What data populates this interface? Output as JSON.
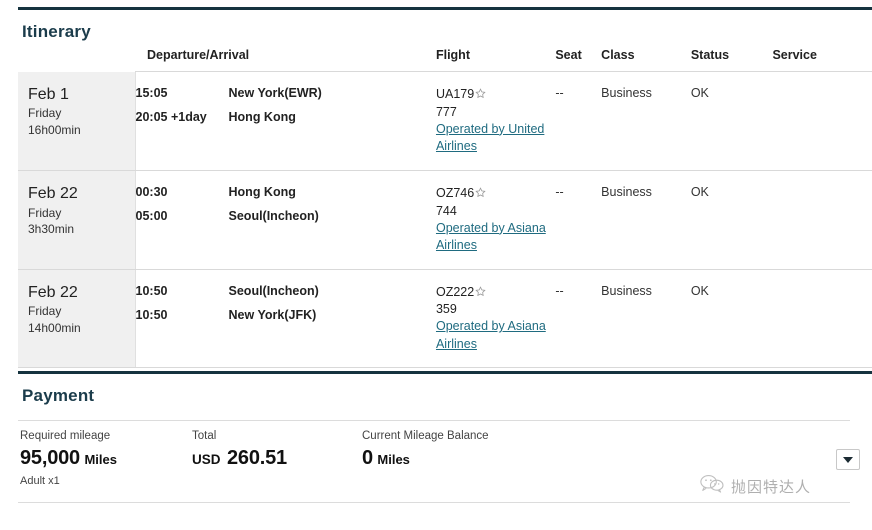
{
  "itinerary": {
    "title": "Itinerary",
    "columns": {
      "date": "",
      "departure_arrival": "Departure/Arrival",
      "flight": "Flight",
      "seat": "Seat",
      "class": "Class",
      "status": "Status",
      "service": "Service"
    },
    "rows": [
      {
        "date": "Feb 1",
        "weekday": "Friday",
        "duration": "16h00min",
        "depart_time": "15:05",
        "depart_place": "New York(EWR)",
        "arrive_time": "20:05 +1day",
        "arrive_place": "Hong Kong",
        "flight_number": "UA179",
        "star_icon": "star-icon",
        "aircraft": "777",
        "operated_by": "Operated by United Airlines",
        "seat": "--",
        "class": "Business",
        "status": "OK",
        "service": ""
      },
      {
        "date": "Feb 22",
        "weekday": "Friday",
        "duration": "3h30min",
        "depart_time": "00:30",
        "depart_place": "Hong Kong",
        "arrive_time": "05:00",
        "arrive_place": "Seoul(Incheon)",
        "flight_number": "OZ746",
        "star_icon": "star-icon",
        "aircraft": "744",
        "operated_by": "Operated by Asiana Airlines",
        "seat": "--",
        "class": "Business",
        "status": "OK",
        "service": ""
      },
      {
        "date": "Feb 22",
        "weekday": "Friday",
        "duration": "14h00min",
        "depart_time": "10:50",
        "depart_place": "Seoul(Incheon)",
        "arrive_time": "10:50",
        "arrive_place": "New York(JFK)",
        "flight_number": "OZ222",
        "star_icon": "star-icon",
        "aircraft": "359",
        "operated_by": "Operated by Asiana Airlines",
        "seat": "--",
        "class": "Business",
        "status": "OK",
        "service": ""
      }
    ]
  },
  "payment": {
    "title": "Payment",
    "required_mileage": {
      "label": "Required mileage",
      "amount": "95,000",
      "unit": "Miles",
      "note": "Adult x1"
    },
    "total": {
      "label": "Total",
      "currency": "USD",
      "amount": "260.51"
    },
    "current_balance": {
      "label": "Current Mileage Balance",
      "amount": "0",
      "unit": "Miles"
    },
    "dropdown_icon": "chevron-down-icon"
  },
  "watermark": {
    "icon": "wechat-icon",
    "text": "抛因特达人"
  },
  "colors": {
    "rule": "#16333f",
    "heading": "#1b3c4b",
    "link": "#1f6b80",
    "date_cell_bg": "#f0f0f0"
  }
}
